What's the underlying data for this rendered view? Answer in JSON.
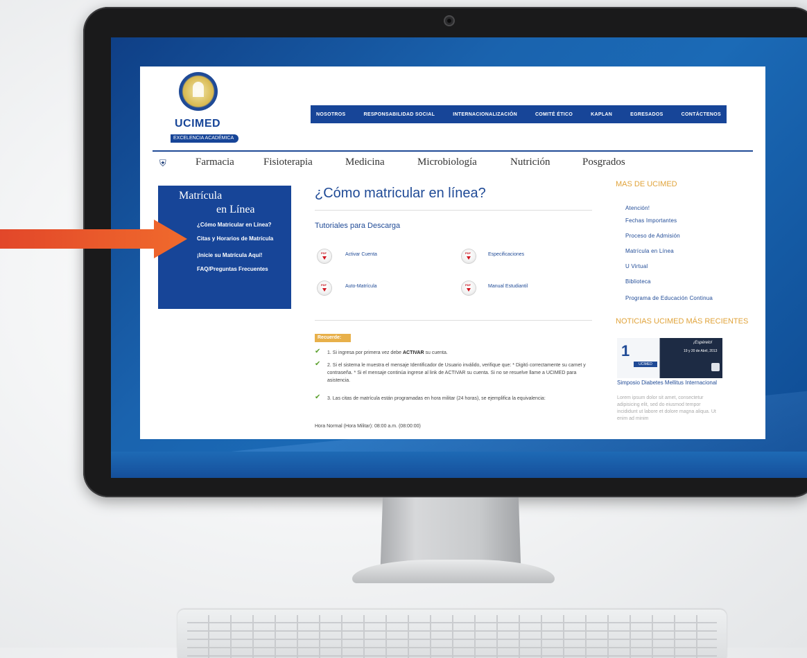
{
  "site": {
    "logo_name": "UCIMED",
    "logo_tagline": "EXCELENCIA ACADÉMICA",
    "top_nav": [
      "NOSOTROS",
      "RESPONSABILIDAD SOCIAL",
      "INTERNACIONALIZACIÓN",
      "COMITÉ ÉTICO",
      "KAPLAN",
      "EGRESADOS",
      "CONTÁCTENOS"
    ],
    "main_nav": [
      "Farmacia",
      "Fisioterapia",
      "Medicina",
      "Microbiología",
      "Nutrición",
      "Posgrados"
    ]
  },
  "sidebar": {
    "title_line1": "Matrícula",
    "title_line2": "en Línea",
    "links": [
      "¿Cómo Matricular en Línea?",
      "Citas y Horarios de Matrícula",
      "¡Inicie su Matrícula Aquí!",
      "FAQ/Preguntas Frecuentes"
    ]
  },
  "content": {
    "title": "¿Cómo matricular en línea?",
    "tutorials_title": "Tutoriales para Descarga",
    "downloads": [
      "Activar Cuenta",
      "Especificaciones",
      "Auto-Matrícula",
      "Manual Estudiantil"
    ],
    "recuerde": "Recuerde:",
    "note1_pre": "1. Si ingresa por primera vez debe ",
    "note1_bold": "ACTIVAR",
    "note1_post": " su cuenta.",
    "note2": "2. Si el sistema le muestra el mensaje Identificador de Usuario inválido, verifique que: * Digitó correctamente su carnet y contraseña. * Si el mensaje continúa ingrese al link de ACTIVAR su cuenta. Si no se resuelve llame a UCIMED para asistencia.",
    "note3": "3. Las citas de matrícula están programadas en hora militar (24 horas), se ejemplifica la equivalencia:",
    "hora": "Hora Normal (Hora Militar): 08:00 a.m. (08:00:00)"
  },
  "right": {
    "mas_title": "MAS DE UCIMED",
    "links": [
      "Atención!",
      "Fechas Importantes",
      "Proceso de Admisión",
      "Matrícula en Línea",
      "U Virtual",
      "Biblioteca",
      "Programa de Educación Continua"
    ],
    "noticias_title": "NOTICIAS UCIMED MÁS RECIENTES",
    "banner_number": "1",
    "banner_text1": "¡Espérelo!",
    "banner_text2": "19 y 20 de Abril, 2013",
    "banner_logo": "UCIMED",
    "news_title": "Simposio Diabetes Mellitus Internacional",
    "news_body": "Lorem ipsum dolor sit amet, consectetur adipisicing elit, sed do eiusmod tempor incididunt ut labore et dolore magna aliqua. Ut enim ad minim"
  },
  "colors": {
    "brand_blue": "#174598",
    "accent_orange": "#e8b04a",
    "arrow": "#e94e2a"
  }
}
